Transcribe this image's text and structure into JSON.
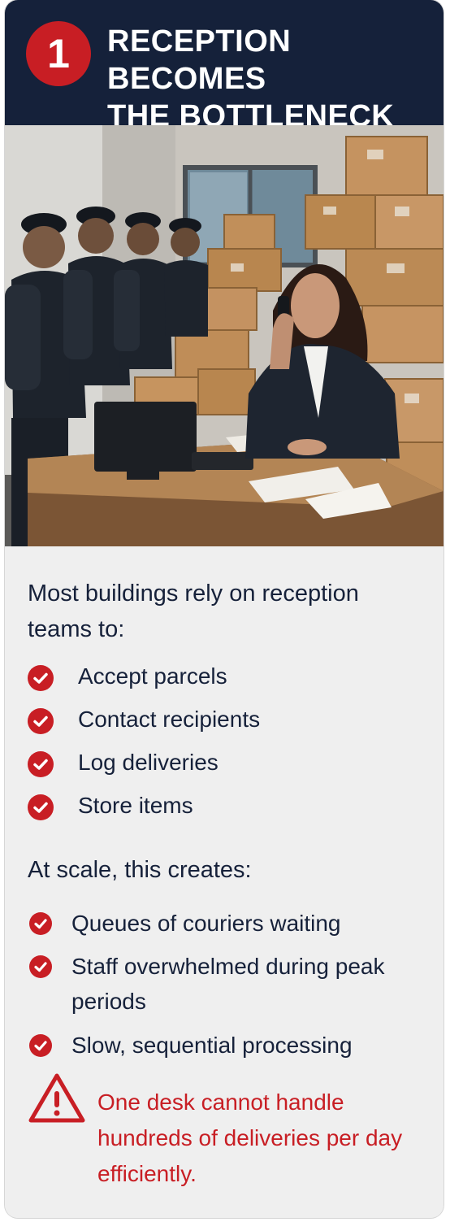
{
  "header": {
    "number": "1",
    "title_line1": "RECEPTION BECOMES",
    "title_line2": "THE BOTTLENECK"
  },
  "illustration": {
    "subject": "reception desk with stacked parcels, a receptionist on the phone, and a queue of couriers"
  },
  "intro": "Most buildings rely on reception teams to:",
  "duties": [
    {
      "label": "Accept parcels"
    },
    {
      "label": "Contact recipients"
    },
    {
      "label": "Log deliveries"
    },
    {
      "label": "Store items"
    }
  ],
  "scale_heading": "At scale, this creates:",
  "problems": [
    {
      "label": "Queues of couriers waiting"
    },
    {
      "label": "Staff overwhelmed during peak periods"
    },
    {
      "label": "Slow, sequential processing"
    }
  ],
  "warning": {
    "icon": "warning-triangle-icon",
    "text": "One desk cannot handle hundreds of deliveries per day efficiently."
  },
  "colors": {
    "header_bg": "#15213a",
    "accent_red": "#c81e24",
    "text_dark": "#16213a",
    "body_bg": "#efefef"
  }
}
